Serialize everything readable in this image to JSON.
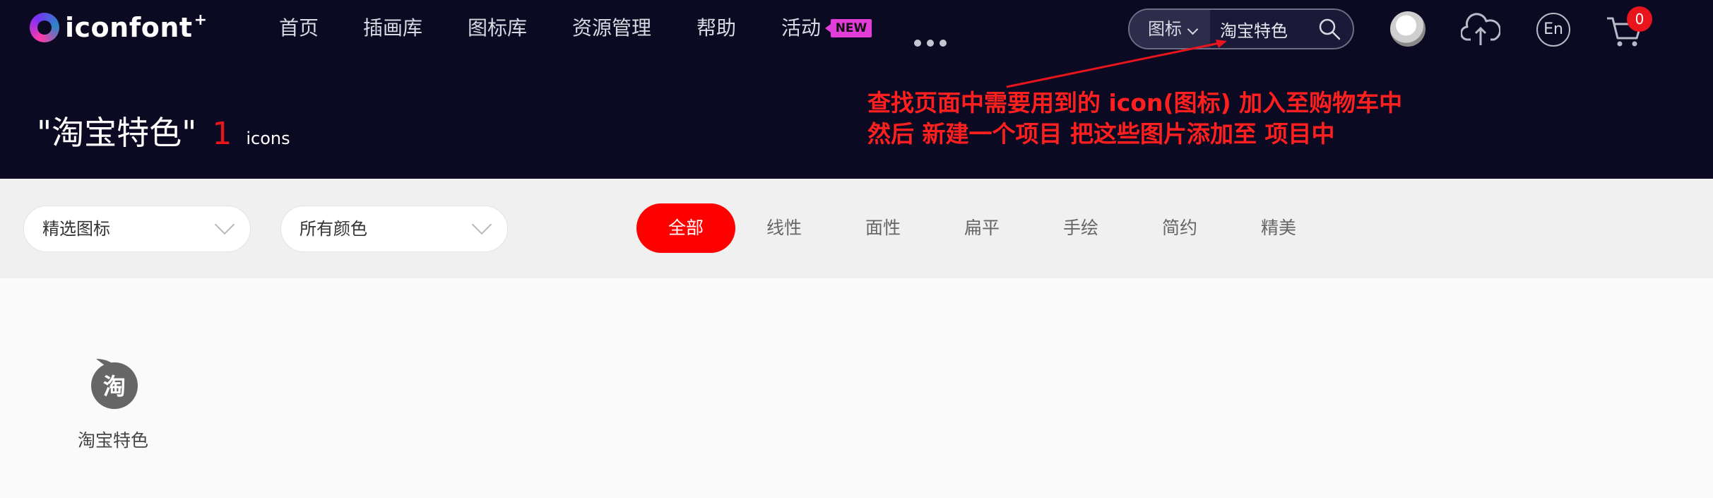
{
  "brand": {
    "name": "iconfont",
    "superscript": "+"
  },
  "nav": {
    "items": [
      "首页",
      "插画库",
      "图标库",
      "资源管理",
      "帮助",
      "活动"
    ],
    "new_badge": "NEW",
    "more_icon": "more-dots-icon"
  },
  "search": {
    "scope": "图标",
    "value": "淘宝特色"
  },
  "header_actions": {
    "language": "En",
    "cart_count": "0",
    "icons": [
      "user-avatar",
      "upload-cloud-icon",
      "language-icon",
      "cart-icon"
    ]
  },
  "result": {
    "query": "\"淘宝特色\"",
    "count": "1",
    "unit": "icons"
  },
  "annotation": {
    "line1": "查找页面中需要用到的 icon(图标) 加入至购物车中",
    "line2": "然后 新建一个项目 把这些图片添加至 项目中",
    "color": "#ff1f1f"
  },
  "filters": {
    "selects": [
      "精选图标",
      "所有颜色"
    ],
    "tabs": [
      "全部",
      "线性",
      "面性",
      "扁平",
      "手绘",
      "简约",
      "精美"
    ],
    "active_tab": "全部"
  },
  "icons": [
    {
      "name": "淘宝特色",
      "glyph": "淘",
      "icon": "taobao-icon"
    }
  ],
  "colors": {
    "header_bg": "#0b0a22",
    "accent": "#ff0000",
    "filter_bg": "#f0f0f0",
    "content_bg": "#fafafa"
  }
}
